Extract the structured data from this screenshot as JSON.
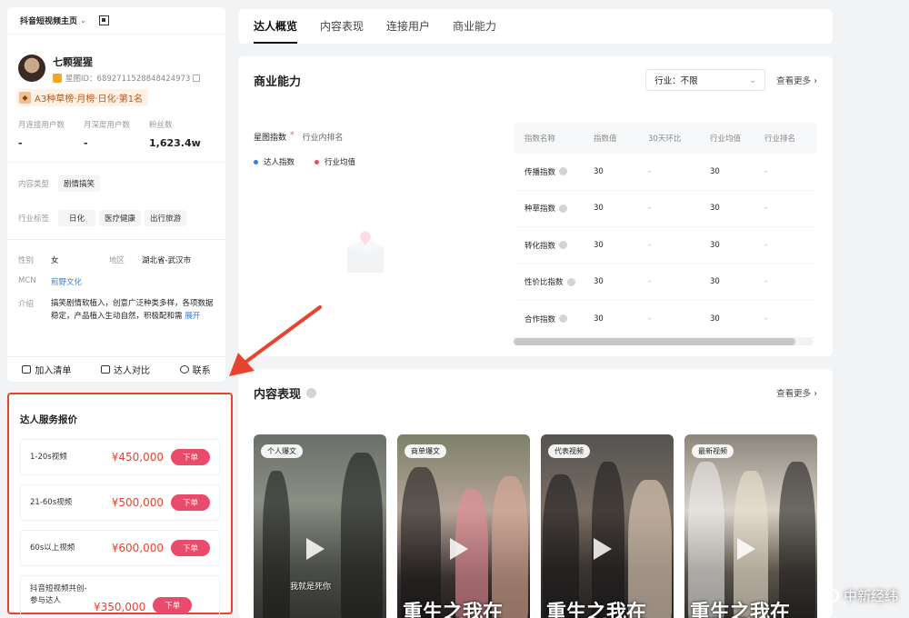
{
  "profile": {
    "platform_label": "抖音短视频主页",
    "name": "七颗猩猩",
    "xingtu_id": "星图ID：6892711528848424973",
    "rank_tag": "A3种草榜·月榜·日化·第1名",
    "stats": [
      {
        "label": "月连接用户数",
        "value": "-"
      },
      {
        "label": "月深度用户数",
        "value": "-"
      },
      {
        "label": "粉丝数",
        "value": "1,623.4w"
      }
    ],
    "content_type_label": "内容类型",
    "content_type_value": "剧情搞笑",
    "industry_label": "行业标签",
    "industry_tags": [
      "日化",
      "医疗健康",
      "出行旅游"
    ],
    "gender_label": "性别",
    "gender_value": "女",
    "region_label": "地区",
    "region_value": "湖北省-武汉市",
    "mcn_label": "MCN",
    "mcn_value": "煎野文化",
    "intro_label": "介绍",
    "intro_value": "搞笑剧情软植入，创意广泛种类多样，各项数据稳定，产品植入生动自然，积极配和需",
    "intro_more": "展开",
    "actions": [
      "加入清单",
      "达人对比",
      "联系"
    ]
  },
  "pricing": {
    "title": "达人服务报价",
    "rows": [
      {
        "label": "1-20s视频",
        "price": "¥450,000",
        "button": "下单"
      },
      {
        "label": "21-60s视频",
        "price": "¥500,000",
        "button": "下单"
      },
      {
        "label": "60s以上视频",
        "price": "¥600,000",
        "button": "下单"
      },
      {
        "label": "抖音短视频共创-参与达人",
        "price": "¥350,000",
        "button": "下单"
      }
    ]
  },
  "tabs": [
    "达人概览",
    "内容表现",
    "连接用户",
    "商业能力"
  ],
  "business": {
    "title": "商业能力",
    "industry_select": "行业：不限",
    "more": "查看更多 ›",
    "index_title": "星图指数",
    "index_star": "*",
    "rank_sub": "行业内排名",
    "legend": [
      {
        "label": "达人指数",
        "color": "#3a7be0"
      },
      {
        "label": "行业均值",
        "color": "#ea4b6a"
      }
    ],
    "table": {
      "headers": [
        "指数名称",
        "指数值",
        "30天环比",
        "行业均值",
        "行业排名"
      ],
      "rows": [
        [
          "传播指数",
          "30",
          "-",
          "30",
          "-"
        ],
        [
          "种草指数",
          "30",
          "-",
          "30",
          "-"
        ],
        [
          "转化指数",
          "30",
          "-",
          "30",
          "-"
        ],
        [
          "性价比指数",
          "30",
          "-",
          "30",
          "-"
        ],
        [
          "合作指数",
          "30",
          "-",
          "30",
          "-"
        ]
      ]
    }
  },
  "content": {
    "title": "内容表现",
    "more": "查看更多 ›",
    "videos": [
      {
        "tag": "个人爆文",
        "caption": "",
        "subtitle": "我就是死你"
      },
      {
        "tag": "商单爆文",
        "caption": "重生之我在",
        "subtitle": ""
      },
      {
        "tag": "代表视频",
        "caption": "重生之我在",
        "subtitle": ""
      },
      {
        "tag": "最新视频",
        "caption": "重生之我在",
        "subtitle": ""
      }
    ]
  },
  "watermark": "中新经纬",
  "colors": {
    "accent": "#ea4b6a",
    "annotation": "#e8432f",
    "price": "#e8432f"
  }
}
